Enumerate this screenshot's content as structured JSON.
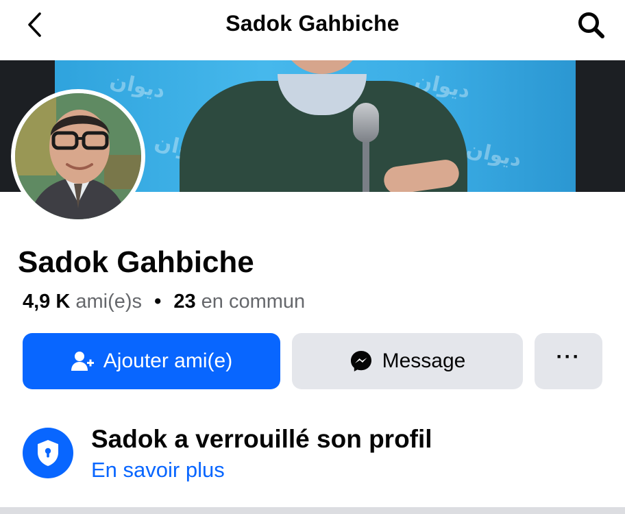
{
  "header": {
    "title": "Sadok Gahbiche",
    "back_icon": "chevron-left-icon",
    "search_icon": "search-icon"
  },
  "cover": {
    "logo_text": "ديوان"
  },
  "profile": {
    "name": "Sadok Gahbiche",
    "friends_count": "4,9 K",
    "friends_label": "ami(e)s",
    "separator": "•",
    "mutual_count": "23",
    "mutual_label": "en commun"
  },
  "actions": {
    "add_friend_label": "Ajouter ami(e)",
    "message_label": "Message",
    "more_label": "···"
  },
  "lock_notice": {
    "title": "Sadok a verrouillé son profil",
    "link": "En savoir plus"
  },
  "colors": {
    "accent": "#0866ff",
    "secondary_button": "#e4e6eb",
    "muted_text": "#65676b"
  }
}
